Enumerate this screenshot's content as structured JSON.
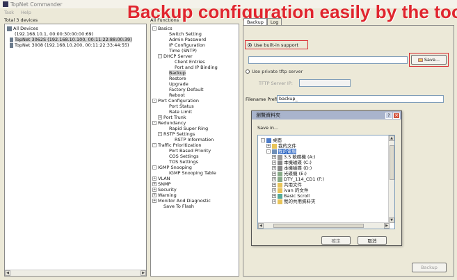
{
  "window": {
    "title": "TopNet Commander",
    "menu": [
      "Task",
      "Help"
    ]
  },
  "banner": {
    "text": "Backup configuration easily by the tool"
  },
  "devices": {
    "header": "Total 3 devices",
    "root": "All Devices",
    "items": [
      "(192.168.10.1, 00:00:30:00:00:69)",
      "TopNet 3062S (192.168.10.100, 00:11:22:88:00:39)",
      "TopNet 3008 (192.168.10.200, 00:11:22:33:44:55)"
    ]
  },
  "functions": {
    "header": "All Functions",
    "items": [
      {
        "label": "Basics",
        "level": 0,
        "exp": "-"
      },
      {
        "label": "Switch Setting",
        "level": 2
      },
      {
        "label": "Admin Password",
        "level": 2
      },
      {
        "label": "IP Configuration",
        "level": 2
      },
      {
        "label": "Time (SNTP)",
        "level": 2
      },
      {
        "label": "DHCP Server",
        "level": 1,
        "exp": "-"
      },
      {
        "label": "Client Entries",
        "level": 3
      },
      {
        "label": "Port and IP Binding",
        "level": 3
      },
      {
        "label": "Backup",
        "level": 2
      },
      {
        "label": "Restore",
        "level": 2
      },
      {
        "label": "Upgrade",
        "level": 2
      },
      {
        "label": "Factory Default",
        "level": 2
      },
      {
        "label": "Reboot",
        "level": 2
      },
      {
        "label": "Port Configuration",
        "level": 0,
        "exp": "-"
      },
      {
        "label": "Port Status",
        "level": 2
      },
      {
        "label": "Rate Limit",
        "level": 2
      },
      {
        "label": "Port Trunk",
        "level": 1,
        "exp": "+"
      },
      {
        "label": "Redundancy",
        "level": 0,
        "exp": "-"
      },
      {
        "label": "Rapid Super Ring",
        "level": 2
      },
      {
        "label": "RSTP Settings",
        "level": 1,
        "exp": "-"
      },
      {
        "label": "RSTP Information",
        "level": 3
      },
      {
        "label": "Traffic Prioritization",
        "level": 0,
        "exp": "-"
      },
      {
        "label": "Port Based Priority",
        "level": 2
      },
      {
        "label": "COS Settings",
        "level": 2
      },
      {
        "label": "TOS Settings",
        "level": 2
      },
      {
        "label": "IGMP Snooping",
        "level": 0,
        "exp": "-"
      },
      {
        "label": "IGMP Snooping Table",
        "level": 2
      },
      {
        "label": "VLAN",
        "level": 0,
        "exp": "+"
      },
      {
        "label": "SNMP",
        "level": 0,
        "exp": "+"
      },
      {
        "label": "Security",
        "level": 0,
        "exp": "+"
      },
      {
        "label": "Warning",
        "level": 0,
        "exp": "+"
      },
      {
        "label": "Monitor And Diagnostic",
        "level": 0,
        "exp": "+"
      },
      {
        "label": "Save To Flash",
        "level": 1
      }
    ]
  },
  "tabs": [
    "Backup",
    "Log"
  ],
  "backup": {
    "radio_builtin": "Use built-in support",
    "save_button": "Save...",
    "radio_tftp": "Use private tftp server",
    "tftp_label": "TFTP Server IP:",
    "filename_label": "Filename Prefix:",
    "filename_value": "backup_",
    "backup_button": "Backup"
  },
  "dialog": {
    "title": "瀏覽資料夾",
    "prompt": "Save in...",
    "items": [
      {
        "label": "桌面",
        "level": 0,
        "exp": "-"
      },
      {
        "label": "我的文件",
        "level": 1,
        "exp": "+"
      },
      {
        "label": "我的電腦",
        "level": 1,
        "exp": "-",
        "sel": true
      },
      {
        "label": "3.5 軟碟機 (A:)",
        "level": 2,
        "exp": "+"
      },
      {
        "label": "本機磁碟 (C:)",
        "level": 2,
        "exp": "+"
      },
      {
        "label": "本機磁碟 (D:)",
        "level": 2,
        "exp": "+"
      },
      {
        "label": "光碟機 (E:)",
        "level": 2,
        "exp": "+"
      },
      {
        "label": "DTY_114_CD1 (F:)",
        "level": 2,
        "exp": "+"
      },
      {
        "label": "共用文件",
        "level": 2,
        "exp": "+"
      },
      {
        "label": "ivan 的文件",
        "level": 2,
        "exp": "+"
      },
      {
        "label": "Basic Scroll",
        "level": 2,
        "exp": "+"
      },
      {
        "label": "我的共用資料夾",
        "level": 2,
        "exp": "+"
      }
    ],
    "ok": "確定",
    "cancel": "取消"
  }
}
